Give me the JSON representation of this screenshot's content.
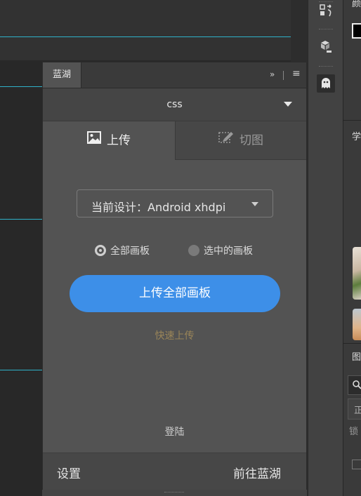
{
  "panel": {
    "tab_title": "蓝湖",
    "expand_glyph": "»",
    "menu_glyph": "≡",
    "css_label": "css",
    "tabs": {
      "upload": "上传",
      "slice": "切图"
    },
    "design_select": {
      "value": "当前设计：Android xhdpi"
    },
    "radios": {
      "all_artboards": "全部画板",
      "selected_artboards": "选中的画板"
    },
    "radio_selected": "all_artboards",
    "upload_button": "上传全部画板",
    "quick_upload": "快速上传",
    "login": "登陆",
    "footer": {
      "settings": "设置",
      "goto_lanhu": "前往蓝湖"
    }
  },
  "right_panel": {
    "labels": [
      "颜",
      "学",
      "图",
      "正",
      "锁"
    ]
  },
  "colors": {
    "accent_blue": "#3d8fe8",
    "guide_cyan": "#2fb2c9",
    "quick_link": "#9a8558"
  },
  "icons": [
    "history-icon",
    "3d-box-icon",
    "plugin-ghost-icon",
    "image-icon",
    "slice-icon",
    "chevron-down-icon",
    "search-icon"
  ]
}
